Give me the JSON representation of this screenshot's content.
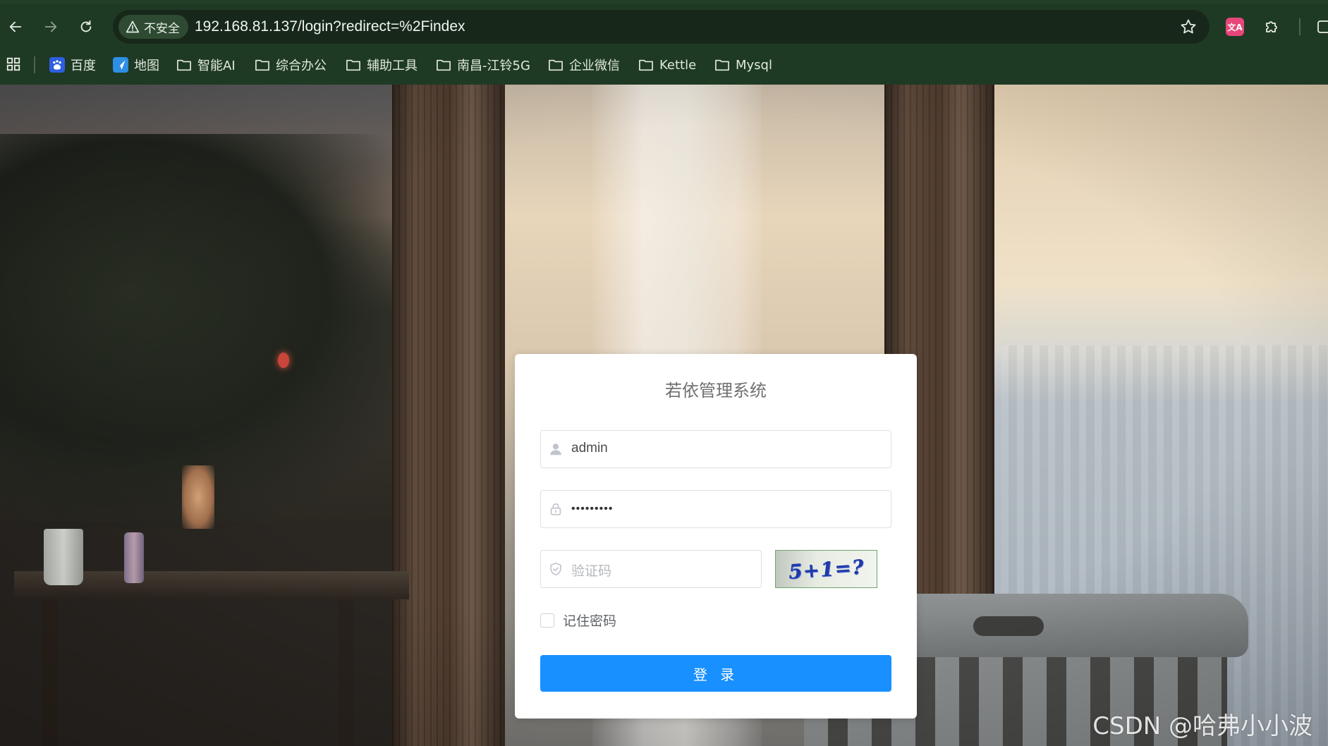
{
  "browser": {
    "security_label": "不安全",
    "url": "192.168.81.137/login?redirect=%2Findex",
    "translate_ext": "文A"
  },
  "bookmarks": [
    {
      "label": "百度",
      "icon": "baidu-icon"
    },
    {
      "label": "地图",
      "icon": "map-icon"
    },
    {
      "label": "智能AI",
      "icon": "folder-icon"
    },
    {
      "label": "综合办公",
      "icon": "folder-icon"
    },
    {
      "label": "辅助工具",
      "icon": "folder-icon"
    },
    {
      "label": "南昌-江铃5G",
      "icon": "folder-icon"
    },
    {
      "label": "企业微信",
      "icon": "folder-icon"
    },
    {
      "label": "Kettle",
      "icon": "folder-icon"
    },
    {
      "label": "Mysql",
      "icon": "folder-icon"
    }
  ],
  "login": {
    "title": "若依管理系统",
    "username_value": "admin",
    "password_mask": "•••••••••",
    "captcha_placeholder": "验证码",
    "captcha_text": "5+1=?",
    "remember_label": "记住密码",
    "submit_label": "登 录"
  },
  "watermark": "CSDN @哈弗小小波",
  "colors": {
    "primary": "#1890ff",
    "chrome_bg": "#1f3a24"
  }
}
